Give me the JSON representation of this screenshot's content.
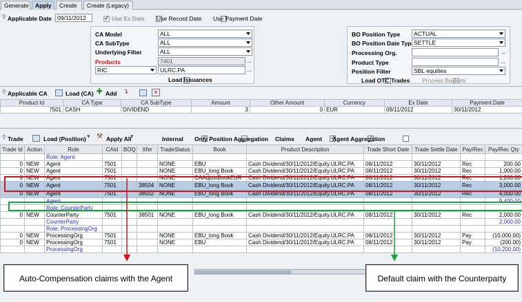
{
  "tabs": [
    "Generate",
    "Apply",
    "Create",
    "Create (Legacy)"
  ],
  "applicable_date": {
    "label": "Applicable Date",
    "value": "09/11/2012"
  },
  "date_options": [
    "Use Ex Date",
    "Use Record Date",
    "Use Payment Date"
  ],
  "filters_left": {
    "ca_model": {
      "label": "CA Model",
      "value": "ALL"
    },
    "ca_subtype": {
      "label": "CA SubType",
      "value": "ALL"
    },
    "underlying_filter": {
      "label": "Underlying Filter",
      "value": "ALL"
    },
    "products": {
      "label": "Products",
      "value": "7401"
    },
    "ric": {
      "select": "RIC",
      "value": "ULRC.PA"
    },
    "load_issuances": "Load Issuances"
  },
  "filters_right": {
    "bo_position_type": {
      "label": "BO Position Type",
      "value": "ACTUAL"
    },
    "bo_position_date_type": {
      "label": "BO Position Date Type",
      "value": "SETTLE"
    },
    "processing_org": {
      "label": "Processing Org.",
      "value": ""
    },
    "product_type": {
      "label": "Product Type",
      "value": ""
    },
    "position_filter": {
      "label": "Position Filter",
      "value": "SBL equities"
    },
    "load_otc_trades": "Load OTC Trades",
    "process_baskets": "Process Baskets"
  },
  "ca_toolbar": {
    "title": "Applicable CA",
    "load": "Load (CA)",
    "add": "Add"
  },
  "ca_table": {
    "headers": [
      "Product Id",
      "CA Type",
      "CA SubType",
      "Amount",
      "Other Amount",
      "Currency",
      "Ex Date",
      "Payment Date"
    ],
    "rows": [
      [
        "7501",
        "CASH",
        "DIVIDEND",
        "3",
        "0",
        "EUR",
        "09/11/2012",
        "30/11/2012"
      ]
    ]
  },
  "trade_toolbar": {
    "title": "Trade",
    "load": "Load (Position)",
    "apply_all": "Apply All",
    "options": [
      {
        "label": "Internal",
        "checked": true
      },
      {
        "label": "Only Position Aggregation",
        "checked": false
      },
      {
        "label": "Claims",
        "checked": true
      },
      {
        "label": "Agent",
        "checked": true
      },
      {
        "label": "Agent Aggregation",
        "checked": false
      }
    ]
  },
  "trade_table": {
    "headers": [
      "Trade Id",
      "Action",
      "Role",
      "CAId",
      "BOQ",
      "Xfer",
      "TradeStatus",
      "Book",
      "Product Description",
      "Trade Short Date",
      "Trade Settle Date",
      "Pay/Rec",
      "Pay/Rec Qty"
    ],
    "rows": [
      {
        "kind": "role",
        "cells": [
          "",
          "",
          "Role: Agent",
          "",
          "",
          "",
          "",
          "",
          "",
          "",
          "",
          "",
          ""
        ]
      },
      {
        "kind": "data",
        "cells": [
          "0",
          "NEW",
          "Agent",
          "7501",
          "",
          "",
          "NONE",
          "EBU",
          "Cash Dividend/30/11/2012/Equity.ULRC.PA",
          "08/11/2012",
          "30/11/2012",
          "Rec",
          "200.00"
        ]
      },
      {
        "kind": "data",
        "cells": [
          "0",
          "NEW",
          "Agent",
          "7501",
          "",
          "",
          "NONE",
          "EBU_long Book",
          "Cash Dividend/30/11/2012/Equity.ULRC.PA",
          "08/11/2012",
          "30/11/2012",
          "Rec",
          "1,000.00"
        ]
      },
      {
        "kind": "data",
        "cells": [
          "0",
          "NEW",
          "Agent",
          "7501",
          "",
          "",
          "NONE",
          "CAAdjustBookEUR",
          "Cash Dividend/30/11/2012/Equity.ULRC.PA",
          "08/11/2012",
          "30/11/2012",
          "Rec",
          "1,200.00"
        ]
      },
      {
        "kind": "sel",
        "cells": [
          "0",
          "NEW",
          "Agent",
          "7501",
          "",
          "38504",
          "NONE",
          "EBU_long Book",
          "Cash Dividend/30/11/2012/Equity.ULRC.PA",
          "08/11/2012",
          "30/11/2012",
          "Rec",
          "3,000.00"
        ]
      },
      {
        "kind": "sel",
        "cells": [
          "0",
          "NEW",
          "Agent",
          "7501",
          "",
          "38502",
          "NONE",
          "EBU_long Book",
          "Cash Dividend/30/11/2012/Equity.ULRC.PA",
          "08/11/2012",
          "30/11/2012",
          "Rec",
          "4,000.00"
        ]
      },
      {
        "kind": "sub",
        "cells": [
          "",
          "",
          "Agent",
          "",
          "",
          "",
          "",
          "",
          "",
          "",
          "",
          "",
          "9,400.00"
        ]
      },
      {
        "kind": "role",
        "cells": [
          "",
          "",
          "Role: CounterParty",
          "",
          "",
          "",
          "",
          "",
          "",
          "",
          "",
          "",
          ""
        ]
      },
      {
        "kind": "data",
        "cells": [
          "0",
          "NEW",
          "CounterParty",
          "7501",
          "",
          "38501",
          "NONE",
          "EBU_long Book",
          "Cash Dividend/30/11/2012/Equity.ULRC.PA",
          "08/11/2012",
          "30/11/2012",
          "Rec",
          "2,000.00"
        ]
      },
      {
        "kind": "sub",
        "cells": [
          "",
          "",
          "CounterParty",
          "",
          "",
          "",
          "",
          "",
          "",
          "",
          "",
          "",
          "2,000.00"
        ]
      },
      {
        "kind": "role",
        "cells": [
          "",
          "",
          "Role: ProcessingOrg",
          "",
          "",
          "",
          "",
          "",
          "",
          "",
          "",
          "",
          ""
        ]
      },
      {
        "kind": "data",
        "cells": [
          "0",
          "NEW",
          "ProcessingOrg",
          "7501",
          "",
          "",
          "NONE",
          "EBU_long Book",
          "Cash Dividend/30/11/2012/Equity.ULRC.PA",
          "08/11/2012",
          "30/11/2012",
          "Pay",
          "(10,000.00)"
        ]
      },
      {
        "kind": "data",
        "cells": [
          "0",
          "NEW",
          "ProcessingOrg",
          "7501",
          "",
          "",
          "NONE",
          "EBU",
          "Cash Dividend/30/11/2012/Equity.ULRC.PA",
          "08/11/2012",
          "30/11/2012",
          "Pay",
          "(200.00)"
        ]
      },
      {
        "kind": "sub",
        "cells": [
          "",
          "",
          "ProcessingOrg",
          "",
          "",
          "",
          "",
          "",
          "",
          "",
          "",
          "",
          "(10,200.00)"
        ]
      }
    ]
  },
  "annotations": {
    "left": "Auto-Compensation claims with the Agent",
    "right": "Default claim with the Counterparty",
    "left_color": "#d0141c",
    "right_color": "#1aa33b"
  }
}
